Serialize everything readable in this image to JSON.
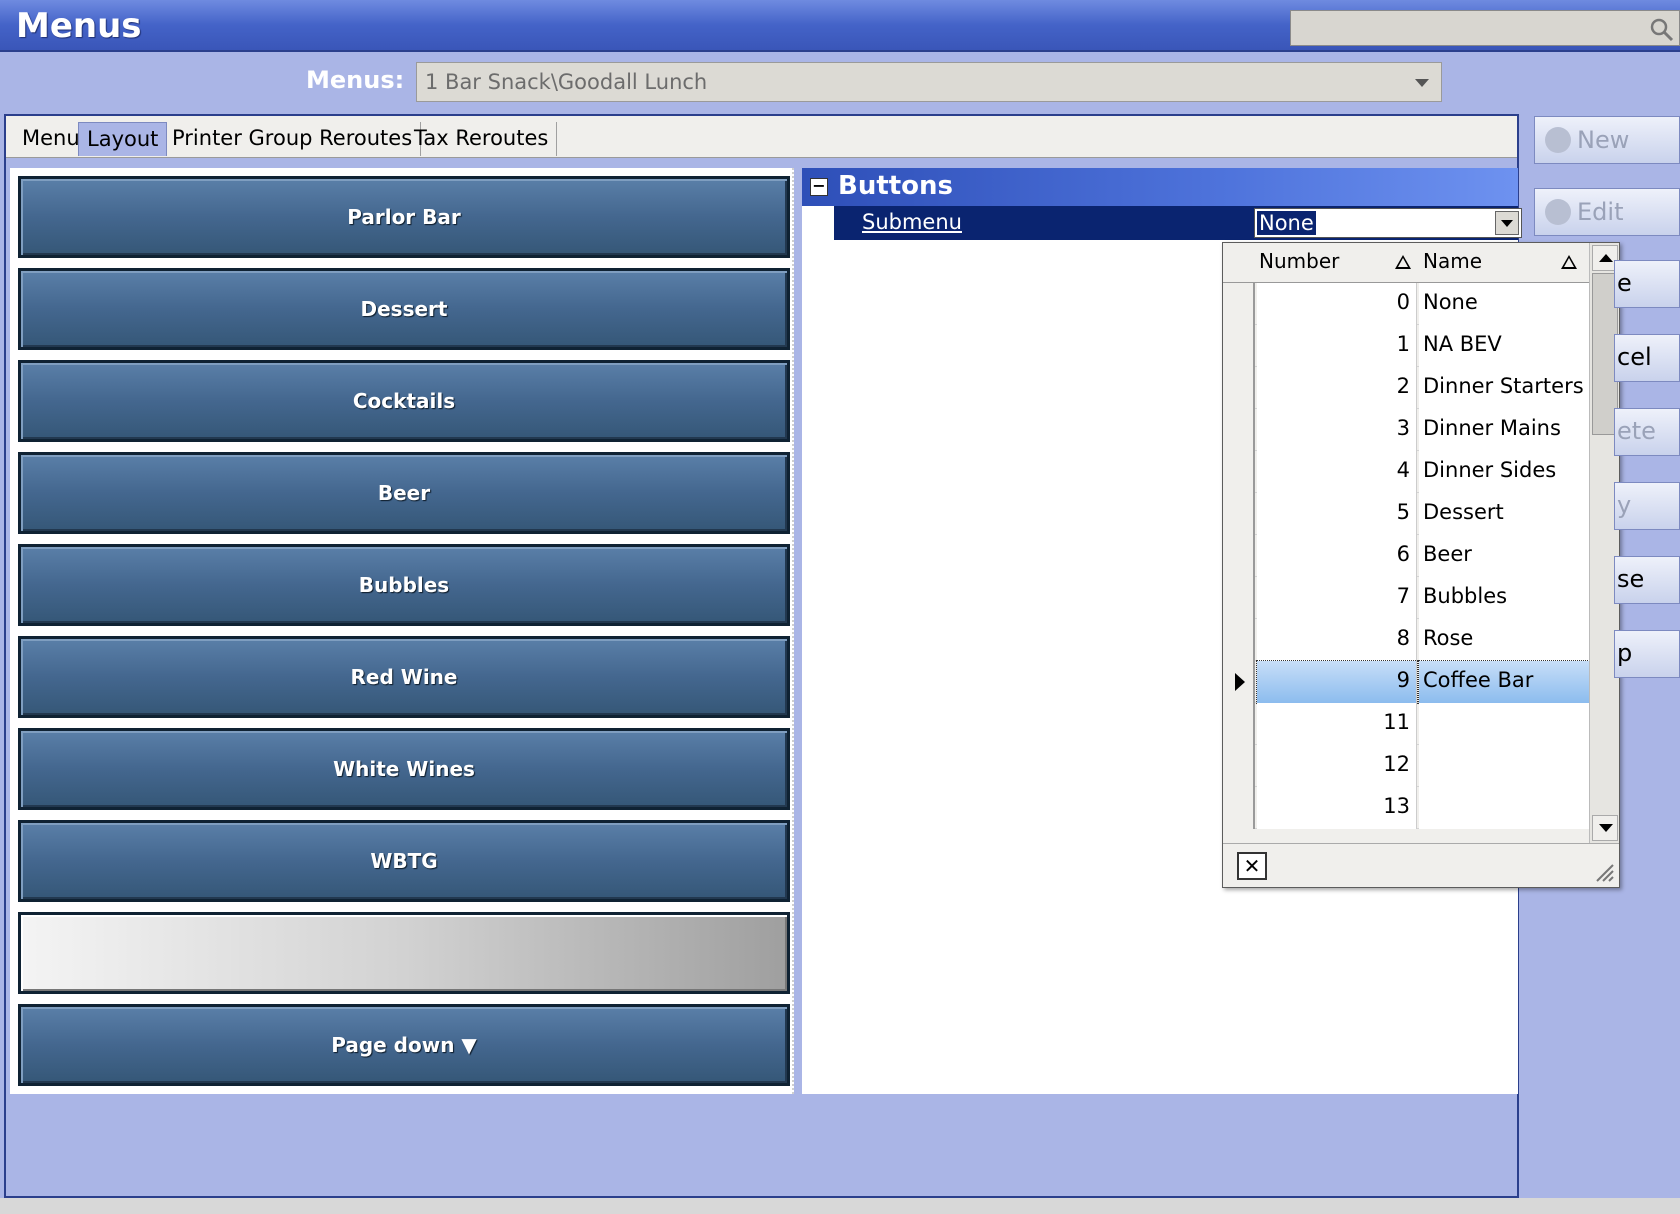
{
  "window": {
    "title": "Menus"
  },
  "search": {
    "placeholder": ""
  },
  "menus_selector": {
    "label": "Menus:",
    "value": "1 Bar Snack\\Goodall Lunch"
  },
  "tabs": [
    {
      "label": "Menu",
      "active": false
    },
    {
      "label": "Layout",
      "active": true
    },
    {
      "label": "Printer Group Reroutes",
      "active": false
    },
    {
      "label": "Tax Reroutes",
      "active": false
    }
  ],
  "layout_buttons": [
    {
      "label": "Parlor Bar"
    },
    {
      "label": "Dessert"
    },
    {
      "label": "Cocktails"
    },
    {
      "label": "Beer"
    },
    {
      "label": "Bubbles"
    },
    {
      "label": "Red Wine"
    },
    {
      "label": "White Wines"
    },
    {
      "label": "WBTG"
    },
    {
      "label": ""
    },
    {
      "label": "Page down ▼"
    }
  ],
  "properties": {
    "section_title": "Buttons",
    "row": {
      "name": "Submenu",
      "value": "None"
    }
  },
  "submenu_dropdown": {
    "columns": {
      "number": "Number",
      "name": "Name"
    },
    "rows": [
      {
        "number": "0",
        "name": "None"
      },
      {
        "number": "1",
        "name": "NA BEV"
      },
      {
        "number": "2",
        "name": "Dinner Starters"
      },
      {
        "number": "3",
        "name": "Dinner Mains"
      },
      {
        "number": "4",
        "name": "Dinner Sides"
      },
      {
        "number": "5",
        "name": "Dessert"
      },
      {
        "number": "6",
        "name": "Beer"
      },
      {
        "number": "7",
        "name": "Bubbles"
      },
      {
        "number": "8",
        "name": "Rose"
      },
      {
        "number": "9",
        "name": "Coffee Bar"
      },
      {
        "number": "11",
        "name": ""
      },
      {
        "number": "12",
        "name": ""
      },
      {
        "number": "13",
        "name": ""
      }
    ],
    "selected_number": "9"
  },
  "actions": {
    "new": "New",
    "edit": "Edit",
    "partial": [
      "e",
      "cel",
      "ete",
      "y",
      "se",
      "p"
    ]
  },
  "colors": {
    "background": "#aab5e6",
    "titlebar": "#4463c8",
    "button_face": "#44678f",
    "selected_row": "#8cbcee",
    "property_header": "#2e4fb8"
  }
}
